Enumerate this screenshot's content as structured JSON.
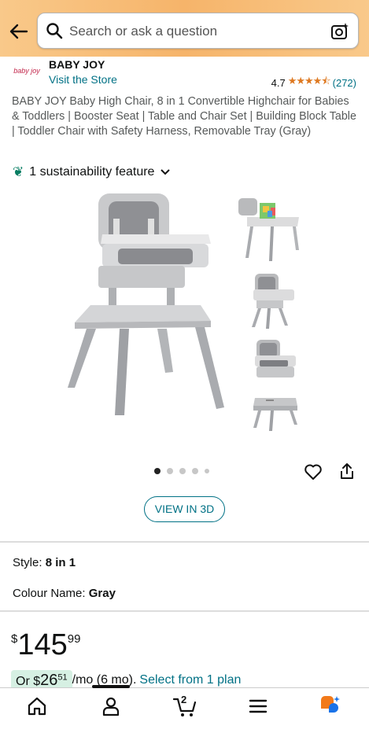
{
  "search": {
    "placeholder": "Search or ask a question"
  },
  "brand": {
    "logo_text": "baby joy",
    "name": "BABY JOY",
    "store_link": "Visit the Store",
    "rating_value": "4.7",
    "rating_stars": 4.7,
    "rating_count": "(272)"
  },
  "product": {
    "title": "BABY JOY Baby High Chair, 8 in 1 Convertible Highchair for Babies & Toddlers | Booster Seat | Table and Chair Set | Building Block Table | Toddler Chair with Safety Harness, Removable Tray (Gray)",
    "sustainability": "1 sustainability feature",
    "view_3d": "VIEW IN 3D",
    "carousel": {
      "total": 5,
      "active": 1
    }
  },
  "variations": {
    "style_label": "Style:",
    "style_value": "8 in 1",
    "colour_label": "Colour Name:",
    "colour_value": "Gray"
  },
  "pricing": {
    "currency": "$",
    "whole": "145",
    "fraction": "99",
    "monthly_prefix": "Or $",
    "monthly_whole": "26",
    "monthly_fraction": "51",
    "monthly_suffix": "/mo (6 mo).",
    "plan_link": "Select from 1 plan"
  },
  "nav": {
    "items": [
      "home-icon",
      "account-icon",
      "cart-icon",
      "menu-icon",
      "rufus-icon"
    ],
    "cart_count": "2",
    "active": "account"
  },
  "colors": {
    "accent_link": "#007185",
    "star": "#de7921",
    "header": "#f6b46a",
    "installment_bg": "#d6f0e3"
  }
}
